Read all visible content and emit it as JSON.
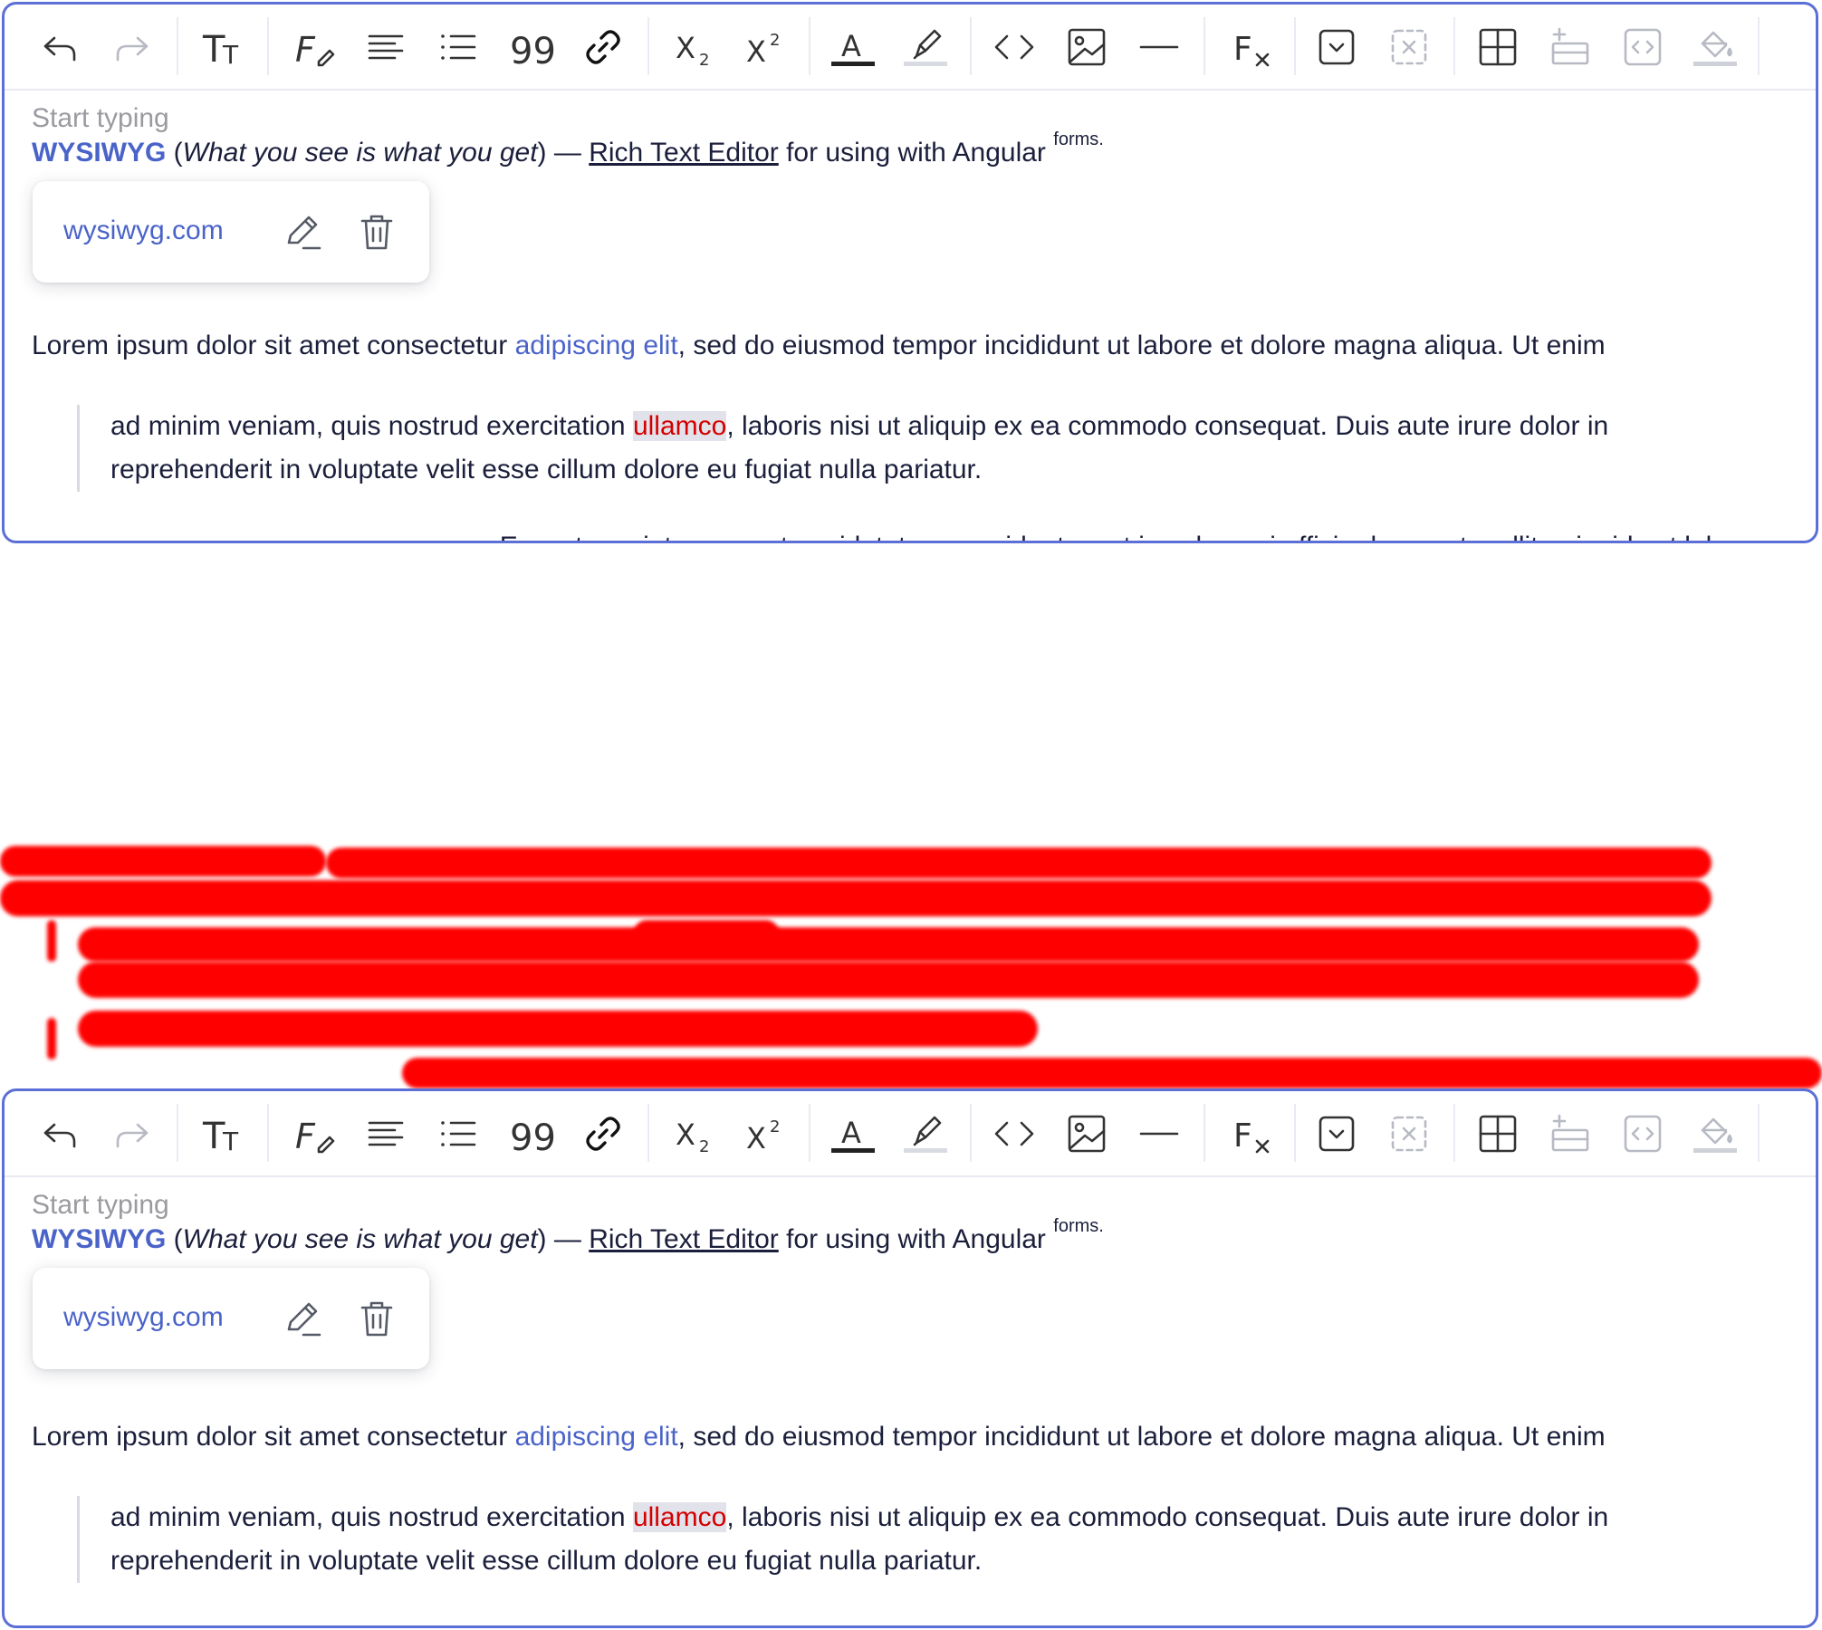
{
  "toolbar": {
    "buttons": [
      {
        "name": "undo-button",
        "icon": "undo-icon"
      },
      {
        "name": "redo-button",
        "icon": "redo-icon"
      },
      {
        "name": "text-size-button",
        "icon": "text-size-icon"
      },
      {
        "name": "font-button",
        "icon": "font-icon"
      },
      {
        "name": "align-button",
        "icon": "align-icon"
      },
      {
        "name": "list-button",
        "icon": "list-icon"
      },
      {
        "name": "quote-button",
        "icon": "quote-icon"
      },
      {
        "name": "link-button",
        "icon": "link-icon"
      },
      {
        "name": "subscript-button",
        "icon": "subscript-icon"
      },
      {
        "name": "superscript-button",
        "icon": "superscript-icon"
      },
      {
        "name": "text-color-button",
        "icon": "text-color-icon"
      },
      {
        "name": "highlight-button",
        "icon": "highlight-icon"
      },
      {
        "name": "code-button",
        "icon": "code-icon"
      },
      {
        "name": "image-button",
        "icon": "image-icon"
      },
      {
        "name": "horizontal-rule-button",
        "icon": "horizontal-rule-icon"
      },
      {
        "name": "clear-format-button",
        "icon": "clear-format-icon"
      },
      {
        "name": "insert-dropdown-button",
        "icon": "dropdown-box-icon"
      },
      {
        "name": "remove-dropdown-button",
        "icon": "remove-box-icon"
      },
      {
        "name": "table-button",
        "icon": "table-icon"
      },
      {
        "name": "add-row-button",
        "icon": "add-row-icon"
      },
      {
        "name": "embed-button",
        "icon": "embed-icon"
      },
      {
        "name": "fill-color-button",
        "icon": "fill-color-icon"
      }
    ],
    "glyphs": {
      "text_size_big": "T",
      "text_size_small": "T",
      "font_f": "F",
      "quote": "99",
      "subscript_x": "X",
      "subscript_2": "2",
      "superscript_x": "X",
      "superscript_2": "2",
      "text_color_a": "A",
      "clear_f": "F",
      "clear_x": "x"
    }
  },
  "editor": {
    "placeholder": "Start typing",
    "line1": {
      "brand": "WYSIWYG",
      "paren_open": " (",
      "italic": "What you see is what you get",
      "paren_close": ") — ",
      "underlined": "Rich Text Editor",
      "rest": " for using with Angular ",
      "sup": "forms."
    },
    "link_popup": {
      "url": "wysiwyg.com",
      "edit_icon": "pencil-icon",
      "delete_icon": "trash-icon"
    },
    "paragraph": {
      "before_link": "Lorem ipsum dolor sit amet consectetur ",
      "link": "adipiscing elit",
      "after_link": ", sed do eiusmod tempor incididunt ut labore et dolore magna aliqua. Ut enim"
    },
    "blockquote": {
      "line1_before": "ad minim veniam, quis nostrud exercitation ",
      "line1_mark": "ullamco",
      "line1_after": ", laboris nisi ut aliquip ex ea commodo consequat. Duis aute irure dolor in",
      "line2": "reprehenderit in voluptate velit esse cillum dolore eu fugiat nulla pariatur."
    },
    "right_paragraph": "Excepteur sint occaecat cupidatat non proident, sunt in culpa qui officia deserunt mollit anim id est laborum."
  },
  "colors": {
    "accent": "#5b6fd6",
    "link": "#4a63c9",
    "mark_text": "#d40000",
    "mark_bg": "#e1e2ea",
    "scribble": "#ff0000"
  }
}
